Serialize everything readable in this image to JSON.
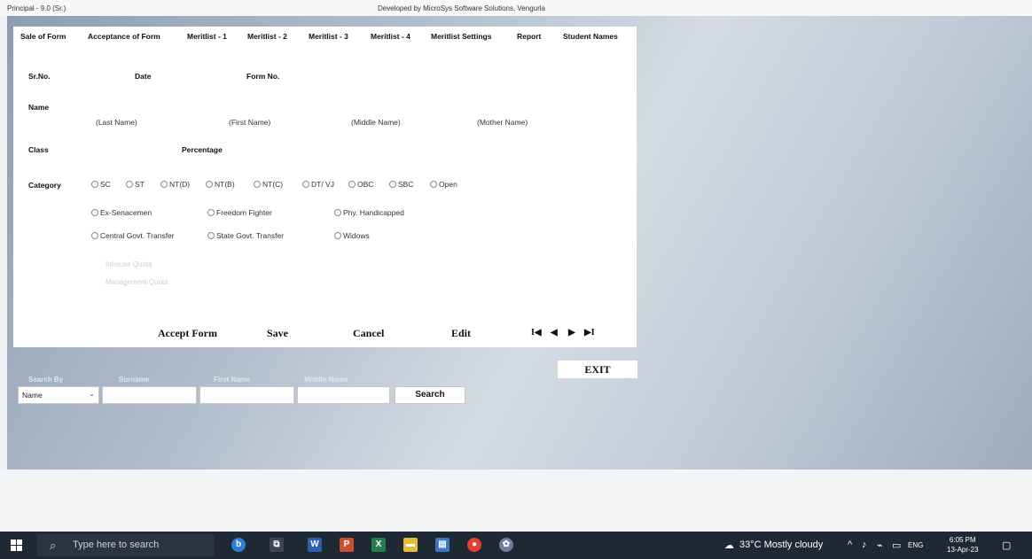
{
  "window": {
    "title": "Principal - 9.0 (Sr.)",
    "developer_credit": "Developed by MicroSys Software Solutions, Vengurla"
  },
  "tabs": [
    {
      "label": "Sale of Form"
    },
    {
      "label": "Acceptance of Form"
    },
    {
      "label": "Meritlist - 1"
    },
    {
      "label": "Meritlist - 2"
    },
    {
      "label": "Meritlist - 3"
    },
    {
      "label": "Meritlist - 4"
    },
    {
      "label": "Meritlist Settings"
    },
    {
      "label": "Report"
    },
    {
      "label": "Student Names"
    }
  ],
  "form": {
    "sr_no_label": "Sr.No.",
    "date_label": "Date",
    "form_no_label": "Form No.",
    "name_label": "Name",
    "last_name_hint": "(Last Name)",
    "first_name_hint": "(First Name)",
    "middle_name_hint": "(Middle Name)",
    "mother_name_hint": "(Mother Name)",
    "class_label": "Class",
    "percentage_label": "Percentage",
    "category_label": "Category",
    "categories": [
      "SC",
      "ST",
      "NT(D)",
      "NT(B)",
      "NT(C)",
      "DT/ VJ",
      "OBC",
      "SBC",
      "Open"
    ],
    "special_row1": [
      "Ex-Senacemen",
      "Freedom Fighter",
      "Phy. Handicapped"
    ],
    "special_row2": [
      "Central Govt. Transfer",
      "State Govt. Transfer",
      "Widows"
    ],
    "quota1": "Inhouse Quota",
    "quota2": "Management Quota"
  },
  "actions": {
    "accept": "Accept Form",
    "save": "Save",
    "cancel": "Cancel",
    "edit": "Edit",
    "first": "I◀",
    "prev": "◀",
    "next": "▶",
    "last": "▶I"
  },
  "exit_label": "EXIT",
  "search": {
    "by_label": "Search By",
    "surname_label": "Surname",
    "first_name_label": "First Name",
    "middle_name_label": "Middle Name",
    "selected_option": "Name",
    "button_label": "Search"
  },
  "taskbar": {
    "search_placeholder": "Type here to search",
    "weather": "33°C  Mostly cloudy",
    "language": "ENG",
    "time": "6:05 PM",
    "date": "13-Apr-23"
  }
}
